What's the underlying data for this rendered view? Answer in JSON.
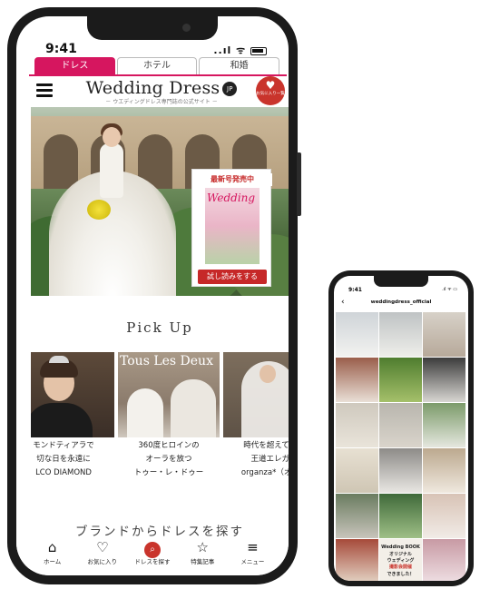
{
  "main_phone": {
    "status": {
      "time": "9:41",
      "signal": "..ıl ᯤ"
    },
    "tabs": [
      {
        "label": "ドレス",
        "active": true
      },
      {
        "label": "ホテル",
        "active": false
      },
      {
        "label": "和婚",
        "active": false
      }
    ],
    "header": {
      "logo_title": "Wedding Dress",
      "logo_jp": "JP",
      "logo_sub": "－ ウエディングドレス専門誌の公式サイト －",
      "favorites_badge": "お気に入り一覧"
    },
    "hero": {
      "magazine_ribbon": "最新号発売中",
      "magazine_cover_title": "Wedding",
      "read_button": "試し読みをする"
    },
    "pickup": {
      "title": "Pick Up",
      "cards": [
        {
          "caption_lines": [
            "モンドティアラで",
            "切な日を永遠に",
            "LCO DIAMOND"
          ]
        },
        {
          "overlay": "Tous Les Deux",
          "caption_lines": [
            "360度ヒロインの",
            "オーラを放つ",
            "トゥー・レ・ドゥー"
          ]
        },
        {
          "caption_lines": [
            "時代を超えて愛さ",
            "王道エレガン",
            "organza*（オルガ"
          ]
        }
      ]
    },
    "brand_search_title": "ブランドからドレスを探す",
    "bottom_nav": [
      {
        "icon": "home-icon",
        "glyph": "⌂",
        "label": "ホーム"
      },
      {
        "icon": "heart-icon",
        "glyph": "♡",
        "label": "お気に入り"
      },
      {
        "icon": "search-icon",
        "glyph": "⌕",
        "label": "ドレスを探す"
      },
      {
        "icon": "star-icon",
        "glyph": "☆",
        "label": "特集記事"
      },
      {
        "icon": "menu-icon",
        "glyph": "≡",
        "label": "メニュー"
      }
    ]
  },
  "small_phone": {
    "status": {
      "time": "9:41",
      "signal": ".ıl ᯤ ▭"
    },
    "back_glyph": "‹",
    "username": "weddingdress_official",
    "grid_text_cells": [
      {
        "lines": [
          "Wedding BOOK",
          "オリジナル",
          "ウェディング",
          "撮影会開催",
          "できました！"
        ]
      }
    ]
  },
  "colors": {
    "accent": "#d6165f",
    "red": "#c9342c"
  }
}
